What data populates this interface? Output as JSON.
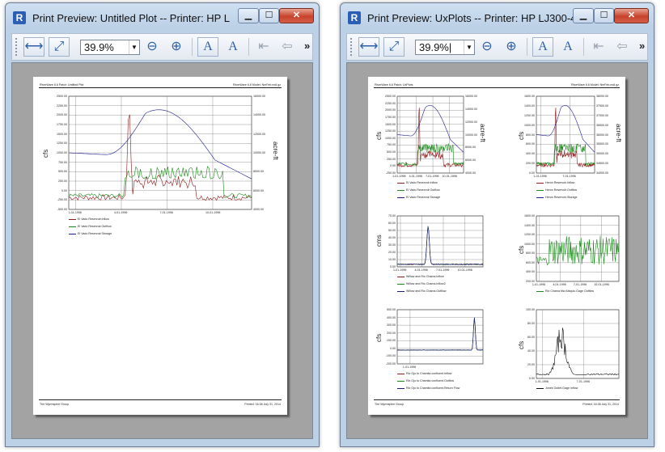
{
  "windows": [
    {
      "title": "Print Preview: Untitled Plot -- Printer: HP LJ300-4...",
      "zoom": "39.9%",
      "buttons": {
        "minimize": "▁",
        "maximize": "☐",
        "close": "✕",
        "more": "»"
      },
      "page": {
        "header_left": "RiverWare 6.6 Patch: Untitled Plot",
        "header_right": "RiverWare 6.6 Model: NmFeb.mdl.gz",
        "footer_left": "The Wyrmspine Group",
        "footer_right": "Printed: 16:38 July 31, 2014"
      },
      "plot": {
        "ylabel_left": "cfs",
        "ylabel_right": "acre-ft",
        "yticks_left": [
          "2500.00",
          "2250.00",
          "2000.00",
          "1750.00",
          "1500.00",
          "1250.00",
          "1000.00",
          "750.00",
          "500.00",
          "250.00",
          "0.00",
          "-250.00",
          "-500.00"
        ],
        "yticks_right": [
          "16000.00",
          "14000.00",
          "12000.00",
          "10000.00",
          "8000.00",
          "6000.00",
          "4000.00"
        ],
        "xticks": [
          "1-01-1996",
          "4-01-1996",
          "7-01-1996",
          "10-01-1996"
        ],
        "legend": [
          "El Vado Reservoir.Inflow",
          "El Vado Reservoir.Outflow",
          "El Vado Reservoir.Storage"
        ]
      }
    },
    {
      "title": "Print Preview: UxPlots -- Printer: HP LJ300-4...",
      "zoom": "39.9%|",
      "buttons": {
        "minimize": "▁",
        "maximize": "☐",
        "close": "✕",
        "more": "»"
      },
      "page": {
        "header_left": "RiverWare 6.6 Patch: UxPlots",
        "header_right": "RiverWare 6.6 Model: NmFeb.mdl.gz",
        "footer_left": "The Wyrmspine Group",
        "footer_right": "Printed: 16:38 July 31, 2014"
      },
      "plots": [
        {
          "ylabel_left": "cfs",
          "ylabel_right": "acre-ft",
          "yticks_left": [
            "2500.00",
            "2250.00",
            "2000.00",
            "1750.00",
            "1500.00",
            "1250.00",
            "1000.00",
            "750.00",
            "500.00",
            "250.00",
            "0.00",
            "-250.00"
          ],
          "yticks_right": [
            "16000.00",
            "14000.00",
            "12000.00",
            "10000.00",
            "8000.00",
            "6000.00",
            "4000.00"
          ],
          "xticks": [
            "1-01-1996",
            "4-01-1996",
            "7-01-1996",
            "10-01-1996"
          ],
          "legend": [
            "El Vado Reservoir.Inflow",
            "El Vado Reservoir.Outflow",
            "El Vado Reservoir.Storage"
          ]
        },
        {
          "ylabel_left": "cfs",
          "ylabel_right": "acre-ft",
          "yticks_left": [
            "1600.00",
            "1400.00",
            "1200.00",
            "1000.00",
            "800.00",
            "600.00",
            "400.00",
            "200.00",
            "0.00"
          ],
          "yticks_right": [
            "38000.00",
            "37500.00",
            "37000.00",
            "36500.00",
            "36000.00",
            "35500.00",
            "35000.00",
            "34500.00",
            "34000.00"
          ],
          "xticks": [
            "1-01-1996",
            "7-01-1996"
          ],
          "legend": [
            "Heron Reservoir.Inflow",
            "Heron Reservoir.Outflow",
            "Heron Reservoir.Storage"
          ]
        },
        {
          "ylabel_left": "cms",
          "yticks_left": [
            "70.00",
            "60.00",
            "50.00",
            "40.00",
            "30.00",
            "20.00",
            "10.00",
            "0.00"
          ],
          "xticks": [
            "1-01-1996",
            "4-01-1996",
            "7-01-1996",
            "10-01-1996"
          ],
          "legend": [
            "Willow and Rio Chama.Inflow",
            "Willow and Rio Chama.Inflow2",
            "Willow and Rio Chama.Outflow"
          ]
        },
        {
          "ylabel_left": "cfs",
          "yticks_left": [
            "1600.00",
            "1400.00",
            "1200.00",
            "1000.00",
            "800.00",
            "600.00",
            "400.00",
            "200.00"
          ],
          "xticks": [
            "1-01-1996",
            "4-01-1996",
            "7-01-1996",
            "10-01-1996"
          ],
          "legend": [
            "Rio Chama blw Abiquiu.Gage Outflow"
          ]
        },
        {
          "ylabel_left": "cfs",
          "yticks_left": [
            "500.00",
            "400.00",
            "300.00",
            "200.00",
            "100.00",
            "0.00",
            "-100.00",
            "-200.00"
          ],
          "xticks": [
            "1-01-1996"
          ],
          "legend": [
            "Rio Ojo to Chamita confluent.Inflow",
            "Rio Ojo to Chamita confluent.Outflow",
            "Rio Ojo to Chamita confluent.Return Flow"
          ]
        },
        {
          "ylabel_left": "cfs",
          "yticks_left": [
            "100.00",
            "80.00",
            "60.00",
            "40.00",
            "20.00",
            "0.00"
          ],
          "xticks": [
            "1-01-1996",
            "7-01-1996"
          ],
          "legend": [
            "Jones Outlet.Gage Inflow"
          ]
        }
      ]
    }
  ],
  "colors": {
    "inflow": "#8b1a1a",
    "outflow": "#1a8a1a",
    "storage": "#1a1a8b",
    "grid": "#555555"
  }
}
